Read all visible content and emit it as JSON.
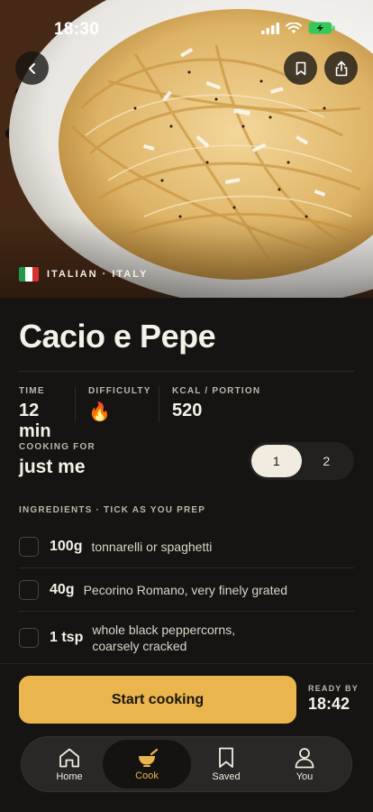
{
  "status_bar": {
    "time": "18:30"
  },
  "hero": {
    "origin": "ITALIAN · ITALY",
    "flag_colors": [
      "#1e9a4a",
      "#ffffff",
      "#d8312f"
    ]
  },
  "recipe": {
    "title": "Cacio e Pepe",
    "stats": [
      {
        "label": "TIME",
        "value": "12 min"
      },
      {
        "label": "DIFFICULTY",
        "value": "🔥"
      },
      {
        "label": "KCAL / PORTION",
        "value": "520"
      }
    ],
    "cooking_for": {
      "label": "COOKING FOR",
      "value": "just me"
    },
    "servings": {
      "options": [
        "1",
        "2"
      ],
      "selected": "1"
    },
    "ingredients_header": "INGREDIENTS · TICK AS YOU PREP",
    "ingredients": [
      {
        "qty": "100g",
        "name": "tonnarelli or spaghetti"
      },
      {
        "qty": "40g",
        "name": "Pecorino Romano, very finely grated"
      },
      {
        "qty": "1 tsp",
        "name": "whole black peppercorns, coarsely cracked"
      }
    ]
  },
  "footer": {
    "start_label": "Start cooking",
    "ready_label": "READY BY",
    "ready_time": "18:42"
  },
  "tabs": [
    {
      "label": "Home",
      "icon": "home-icon"
    },
    {
      "label": "Cook",
      "icon": "pot-icon",
      "active": true
    },
    {
      "label": "Saved",
      "icon": "bookmark-icon"
    },
    {
      "label": "You",
      "icon": "person-icon"
    }
  ],
  "colors": {
    "accent": "#eab54c",
    "background": "#151412"
  }
}
